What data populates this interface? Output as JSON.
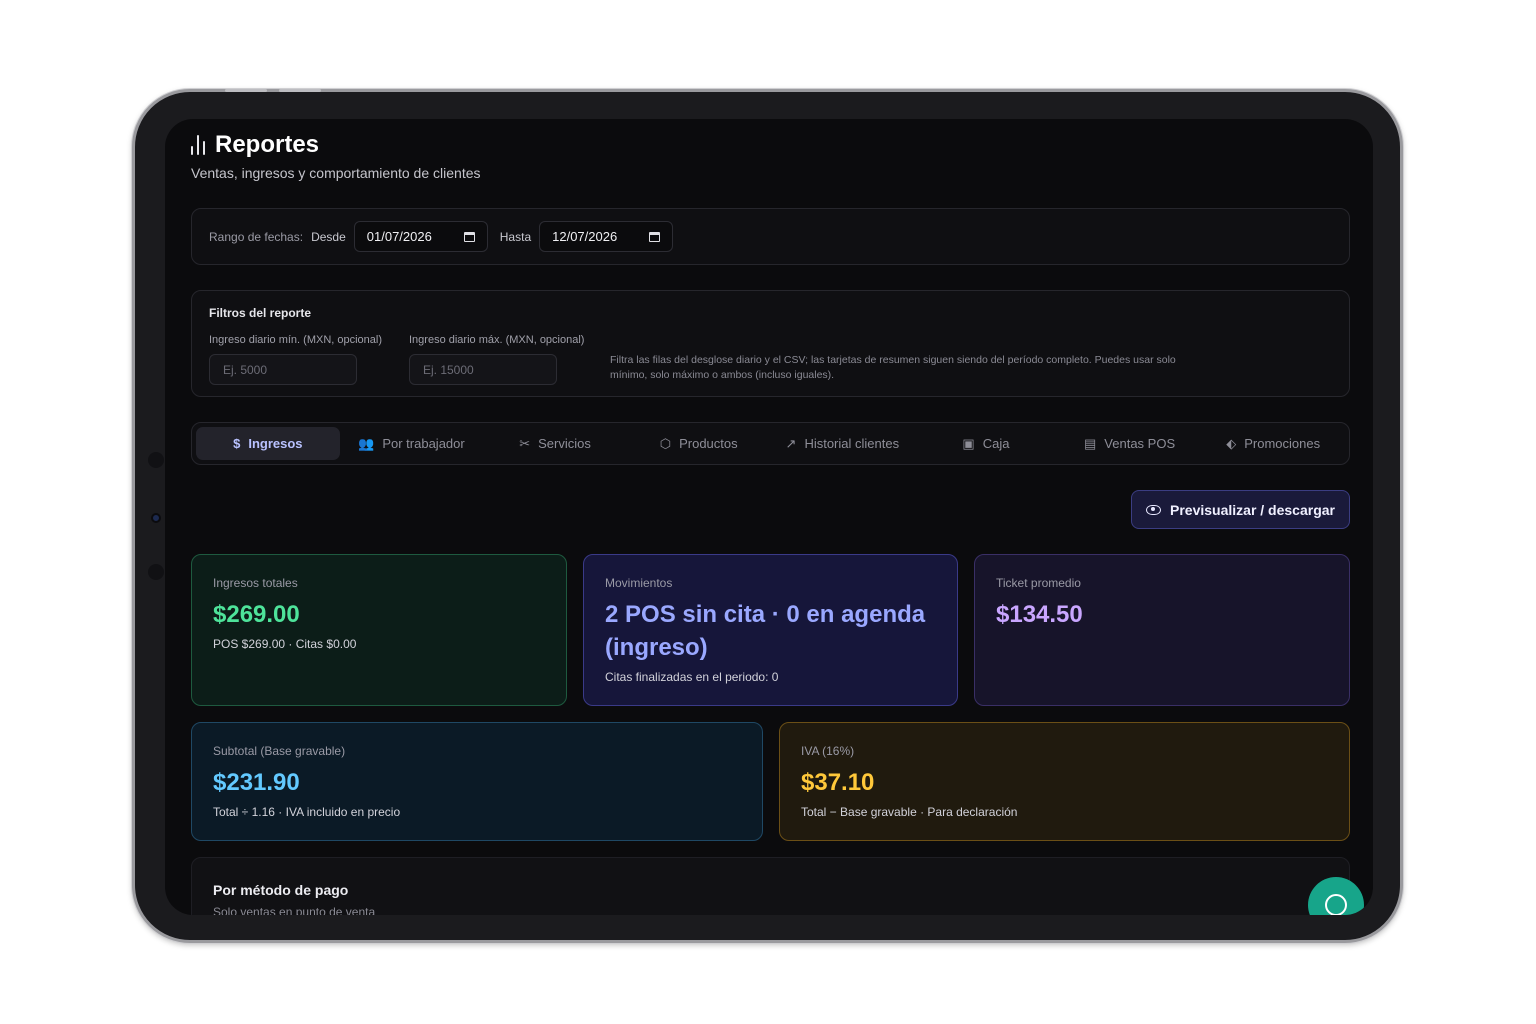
{
  "header": {
    "title": "Reportes",
    "subtitle": "Ventas, ingresos y comportamiento de clientes",
    "title_icon": "bar-chart-icon"
  },
  "date_range": {
    "label": "Rango de fechas:",
    "from_label": "Desde",
    "from_value": "01/07/2026",
    "to_label": "Hasta",
    "to_value": "12/07/2026"
  },
  "filters": {
    "title": "Filtros del reporte",
    "min_label": "Ingreso diario mín. (MXN, opcional)",
    "min_placeholder": "Ej. 5000",
    "max_label": "Ingreso diario máx. (MXN, opcional)",
    "max_placeholder": "Ej. 15000",
    "note": "Filtra las filas del desglose diario y el CSV; las tarjetas de resumen siguen siendo del período completo. Puedes usar solo mínimo, solo máximo o ambos (incluso iguales)."
  },
  "tabs": [
    {
      "label": "Ingresos",
      "icon": "dollar-icon",
      "glyph": "$"
    },
    {
      "label": "Por trabajador",
      "icon": "users-icon",
      "glyph": "👥"
    },
    {
      "label": "Servicios",
      "icon": "scissors-icon",
      "glyph": "✂"
    },
    {
      "label": "Productos",
      "icon": "box-icon",
      "glyph": "⬡"
    },
    {
      "label": "Historial clientes",
      "icon": "trending-up-icon",
      "glyph": "↗"
    },
    {
      "label": "Caja",
      "icon": "wallet-icon",
      "glyph": "▣"
    },
    {
      "label": "Ventas POS",
      "icon": "receipt-icon",
      "glyph": "▤"
    },
    {
      "label": "Promociones",
      "icon": "tag-icon",
      "glyph": "⬖"
    }
  ],
  "active_tab": "Ingresos",
  "preview_button": "Previsualizar / descargar",
  "cards": {
    "ingresos": {
      "label": "Ingresos totales",
      "value": "$269.00",
      "sub": "POS $269.00 · Citas $0.00"
    },
    "movimientos": {
      "label": "Movimientos",
      "value": "2 POS sin cita · 0 en agenda (ingreso)",
      "sub": "Citas finalizadas en el periodo: 0"
    },
    "ticket": {
      "label": "Ticket promedio",
      "value": "$134.50"
    },
    "subtotal": {
      "label": "Subtotal (Base gravable)",
      "value": "$231.90",
      "sub": "Total ÷ 1.16 · IVA incluido en precio"
    },
    "iva": {
      "label": "IVA (16%)",
      "value": "$37.10",
      "sub": "Total − Base gravable · Para declaración"
    }
  },
  "payment": {
    "title": "Por método de pago",
    "subtitle": "Solo ventas en punto de venta"
  },
  "colors": {
    "accent": "#b9c2ff",
    "green": "#4ee39a",
    "indigo": "#9aa8ff",
    "violet": "#c9a6ff",
    "sky": "#63c9ff",
    "amber": "#ffc83a",
    "fab": "#17a58a"
  }
}
